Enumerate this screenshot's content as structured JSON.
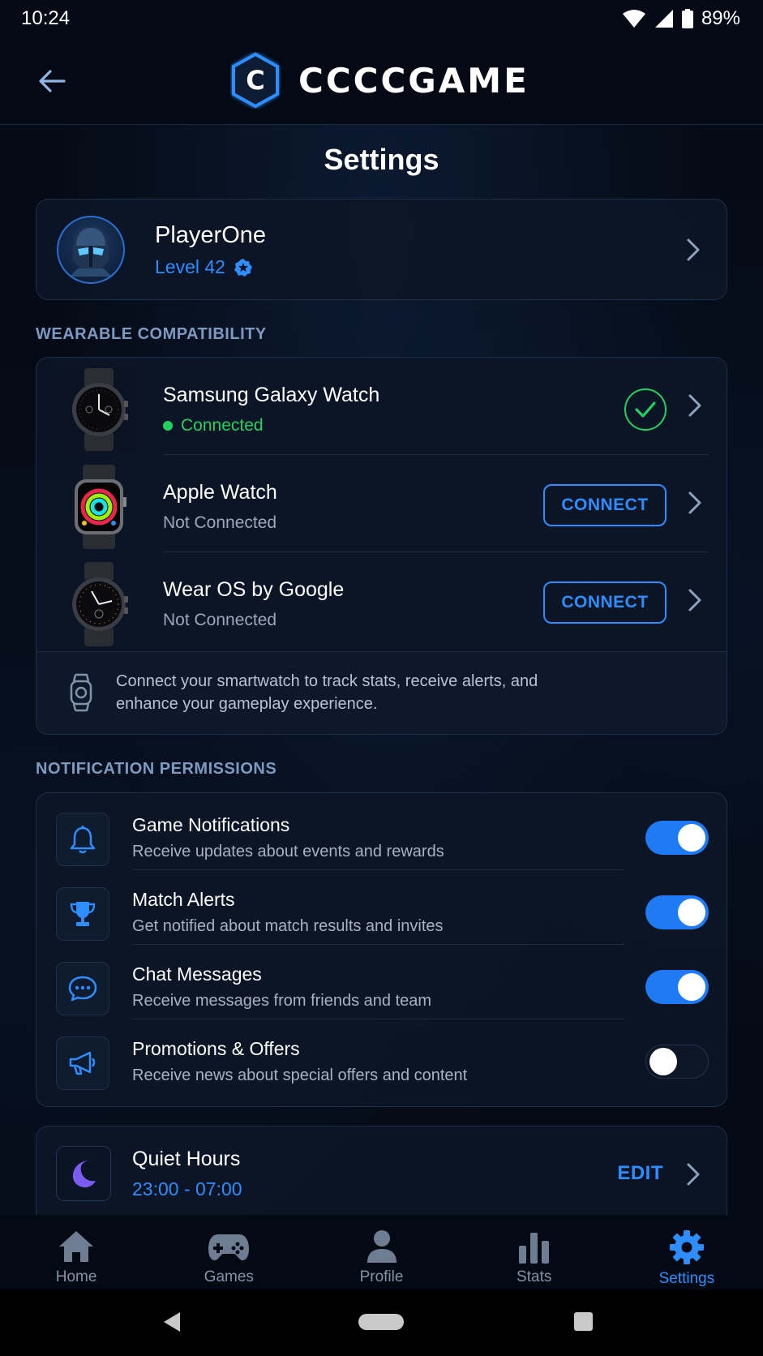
{
  "status_bar": {
    "time": "10:24",
    "battery": "89%"
  },
  "header": {
    "brand": "CCCCGAME",
    "logo_letter": "C"
  },
  "page_title": "Settings",
  "profile": {
    "name": "PlayerOne",
    "level": "Level 42"
  },
  "wearables": {
    "section_label": "WEARABLE COMPATIBILITY",
    "devices": [
      {
        "name": "Samsung Galaxy Watch",
        "status": "Connected",
        "connected": true
      },
      {
        "name": "Apple Watch",
        "status": "Not Connected",
        "connected": false,
        "action": "CONNECT"
      },
      {
        "name": "Wear OS by Google",
        "status": "Not Connected",
        "connected": false,
        "action": "CONNECT"
      }
    ],
    "info_text": "Connect your smartwatch to track stats, receive alerts, and enhance your gameplay experience."
  },
  "notifications": {
    "section_label": "NOTIFICATION PERMISSIONS",
    "items": [
      {
        "title": "Game Notifications",
        "description": "Receive updates about events and rewards",
        "enabled": true,
        "icon": "bell-icon"
      },
      {
        "title": "Match Alerts",
        "description": "Get notified about match results and invites",
        "enabled": true,
        "icon": "trophy-icon"
      },
      {
        "title": "Chat Messages",
        "description": "Receive messages from friends and team",
        "enabled": true,
        "icon": "chat-icon"
      },
      {
        "title": "Promotions & Offers",
        "description": "Receive news about special offers and content",
        "enabled": false,
        "icon": "megaphone-icon"
      }
    ]
  },
  "quiet_hours": {
    "title": "Quiet Hours",
    "time": "23:00 - 07:00",
    "action": "EDIT"
  },
  "bottom_nav": {
    "items": [
      {
        "label": "Home",
        "icon": "home-icon"
      },
      {
        "label": "Games",
        "icon": "gamepad-icon"
      },
      {
        "label": "Profile",
        "icon": "person-icon"
      },
      {
        "label": "Stats",
        "icon": "bar-chart-icon"
      },
      {
        "label": "Settings",
        "icon": "gear-icon",
        "active": true
      }
    ]
  },
  "colors": {
    "accent": "#2e8dff",
    "success": "#23d160",
    "background": "#050b16",
    "card": "#0c1626"
  }
}
